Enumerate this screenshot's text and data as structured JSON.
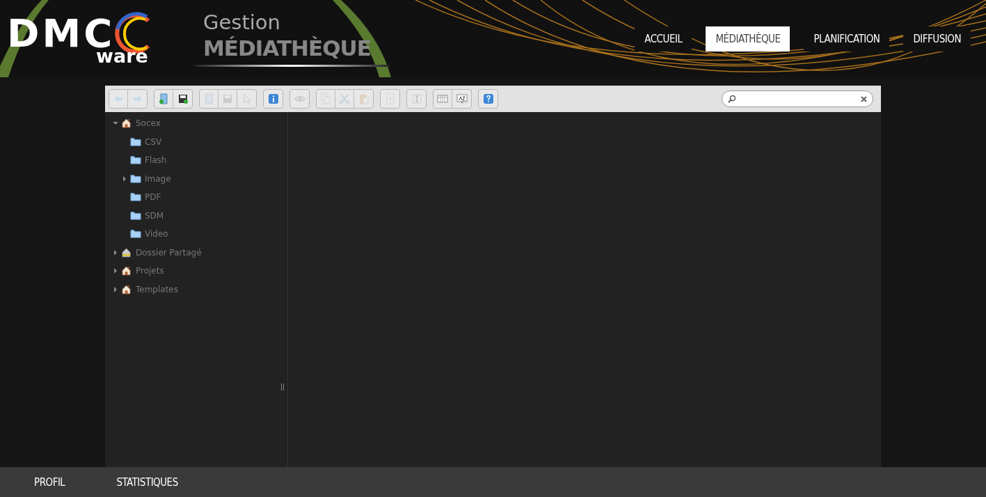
{
  "logo": {
    "letters": "DMC",
    "sub": "ware"
  },
  "banner": {
    "line1": "Gestion",
    "line2": "MÉDIATHÈQUE"
  },
  "nav": [
    {
      "label": "ACCUEIL",
      "selected": false
    },
    {
      "label": "MÉDIATHÈQUE",
      "selected": true
    },
    {
      "label": "PLANIFICATION",
      "selected": false
    },
    {
      "label": "DIFFUSION",
      "selected": false
    }
  ],
  "toolbar": [
    [
      {
        "kind": "back",
        "disabled": true
      },
      {
        "kind": "forward",
        "disabled": true
      }
    ],
    [
      {
        "kind": "newfolder",
        "disabled": false
      },
      {
        "kind": "savenew",
        "disabled": false
      }
    ],
    [
      {
        "kind": "folder",
        "disabled": true
      },
      {
        "kind": "save",
        "disabled": true
      },
      {
        "kind": "pointer",
        "disabled": true
      }
    ],
    [
      {
        "kind": "info",
        "disabled": false
      }
    ],
    [
      {
        "kind": "eye",
        "disabled": true
      }
    ],
    [
      {
        "kind": "copy",
        "disabled": true
      },
      {
        "kind": "cut",
        "disabled": true
      },
      {
        "kind": "paste",
        "disabled": true
      }
    ],
    [
      {
        "kind": "clipboard",
        "disabled": true
      }
    ],
    [
      {
        "kind": "select",
        "disabled": true
      }
    ],
    [
      {
        "kind": "columns",
        "disabled": false
      },
      {
        "kind": "sort",
        "disabled": false
      }
    ],
    [
      {
        "kind": "help",
        "disabled": false
      }
    ]
  ],
  "tree": [
    {
      "label": "Socex",
      "kind": "root",
      "expanded": true,
      "children": [
        {
          "label": "CSV",
          "kind": "folder"
        },
        {
          "label": "Flash",
          "kind": "folder"
        },
        {
          "label": "Image",
          "kind": "folder",
          "expanded": false
        },
        {
          "label": "PDF",
          "kind": "folder"
        },
        {
          "label": "SDM",
          "kind": "folder"
        },
        {
          "label": "Video",
          "kind": "folder"
        }
      ]
    },
    {
      "label": "Dossier Partagé",
      "kind": "shared",
      "expanded": false
    },
    {
      "label": "Projets",
      "kind": "root",
      "expanded": false
    },
    {
      "label": "Templates",
      "kind": "root",
      "expanded": false
    }
  ],
  "footer": [
    {
      "label": "PROFIL"
    },
    {
      "label": "STATISTIQUES"
    }
  ]
}
